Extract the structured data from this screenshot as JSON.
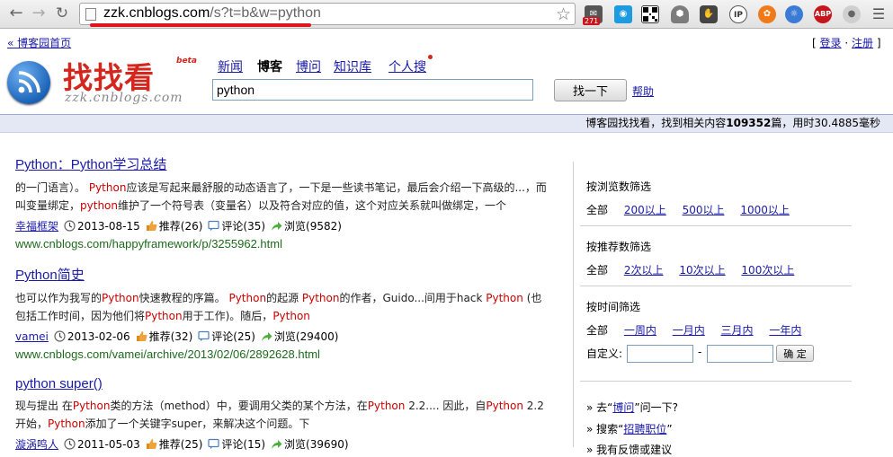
{
  "browser": {
    "url_host": "zzk.cnblogs.com",
    "url_path": "/s?t=b&w=python",
    "ext_badge_count": "271",
    "ext_qr_label": "",
    "ext_ip_label": "IP",
    "ext_abp_label": "ABP"
  },
  "header": {
    "home_link": "« 博客园首页",
    "login": "登录",
    "separator": "·",
    "register": "注册",
    "bracket_open": "[",
    "bracket_close": "]",
    "logo_title": "找找看",
    "logo_beta": "beta",
    "logo_url": "zzk.cnblogs.com",
    "tabs": [
      "新闻",
      "博客",
      "博问",
      "知识库",
      "个人搜"
    ],
    "search_value": "python",
    "search_button": "找一下",
    "help": "帮助"
  },
  "stats": {
    "prefix": "博客园找找看，找到相关内容",
    "count": "109352",
    "middle": "篇，用时",
    "time": "30.4885毫秒"
  },
  "results": [
    {
      "title_parts": [
        {
          "t": "Python",
          "kw": false
        },
        {
          "t": "：",
          "kw": false
        },
        {
          "t": "Python",
          "kw": false
        },
        {
          "t": "学习总结",
          "kw": false
        }
      ],
      "snippet_lines": [
        [
          {
            "t": "的一门语言）。 ",
            "kw": false
          },
          {
            "t": "Python",
            "kw": true
          },
          {
            "t": "应该是写起来最舒服的动态语言了，一下是一些读书笔记，最后会介绍一下高级的...，而",
            "kw": false
          }
        ],
        [
          {
            "t": "叫变量绑定，",
            "kw": false
          },
          {
            "t": "python",
            "kw": true
          },
          {
            "t": "维护了一个符号表（变量名）以及符合对应的值，这个对应关系就叫做绑定，一个",
            "kw": false
          }
        ]
      ],
      "author": "幸福框架",
      "date": "2013-08-15",
      "recommend": "推荐(26)",
      "comments": "评论(35)",
      "views": "浏览(9582)",
      "url": "www.cnblogs.com/happyframework/p/3255962.html"
    },
    {
      "title_parts": [
        {
          "t": "Python",
          "kw": false
        },
        {
          "t": "简史",
          "kw": false
        }
      ],
      "snippet_lines": [
        [
          {
            "t": "也可以作为我写的",
            "kw": false
          },
          {
            "t": "Python",
            "kw": true
          },
          {
            "t": "快速教程的序篇。 ",
            "kw": false
          },
          {
            "t": "Python",
            "kw": true
          },
          {
            "t": "的起源 ",
            "kw": false
          },
          {
            "t": "Python",
            "kw": true
          },
          {
            "t": "的作者，Guido...间用于hack ",
            "kw": false
          },
          {
            "t": "Python",
            "kw": true
          },
          {
            "t": " (也",
            "kw": false
          }
        ],
        [
          {
            "t": "包括工作时间，因为他们将",
            "kw": false
          },
          {
            "t": "Python",
            "kw": true
          },
          {
            "t": "用于工作)。随后，",
            "kw": false
          },
          {
            "t": "Python",
            "kw": true
          }
        ]
      ],
      "author": "vamei",
      "date": "2013-02-06",
      "recommend": "推荐(32)",
      "comments": "评论(25)",
      "views": "浏览(29400)",
      "url": "www.cnblogs.com/vamei/archive/2013/02/06/2892628.html"
    },
    {
      "title_parts": [
        {
          "t": "python super()",
          "kw": false
        }
      ],
      "snippet_lines": [
        [
          {
            "t": "现与提出 在",
            "kw": false
          },
          {
            "t": "Python",
            "kw": true
          },
          {
            "t": "类的方法（method）中，要调用父类的某个方法，在",
            "kw": false
          },
          {
            "t": "Python",
            "kw": true
          },
          {
            "t": " 2.2....  因此，自",
            "kw": false
          },
          {
            "t": "Python",
            "kw": true
          },
          {
            "t": " 2.2",
            "kw": false
          }
        ],
        [
          {
            "t": "开始，",
            "kw": false
          },
          {
            "t": "Python",
            "kw": true
          },
          {
            "t": "添加了一个关键字super，来解决这个问题。下",
            "kw": false
          }
        ]
      ],
      "author": "漩涡鸣人",
      "date": "2011-05-03",
      "recommend": "推荐(25)",
      "comments": "评论(15)",
      "views": "浏览(39690)",
      "url": ""
    }
  ],
  "sidebar": {
    "views_heading": "按浏览数筛选",
    "views_all": "全部",
    "views_options": [
      "200以上",
      "500以上",
      "1000以上"
    ],
    "rec_heading": "按推荐数筛选",
    "rec_all": "全部",
    "rec_options": [
      "2次以上",
      "10次以上",
      "100次以上"
    ],
    "time_heading": "按时间筛选",
    "time_all": "全部",
    "time_options": [
      "一周内",
      "一月内",
      "三月内",
      "一年内"
    ],
    "custom_label": "自定义:",
    "custom_dash": "-",
    "custom_button": "确 定",
    "link1_prefix": "» 去“",
    "link1_text": "博问",
    "link1_suffix": "”问一下?",
    "link2_prefix": "» 搜索“",
    "link2_text": "招聘职位",
    "link2_suffix": "”",
    "link3_text": "» 我有反馈或建议"
  },
  "colors": {
    "keyword": "#cc0000",
    "link": "#1a1aa6",
    "url_green": "#1c6a1c",
    "brand_red": "#d4261d",
    "statbar_bg": "#e3e8f4"
  }
}
